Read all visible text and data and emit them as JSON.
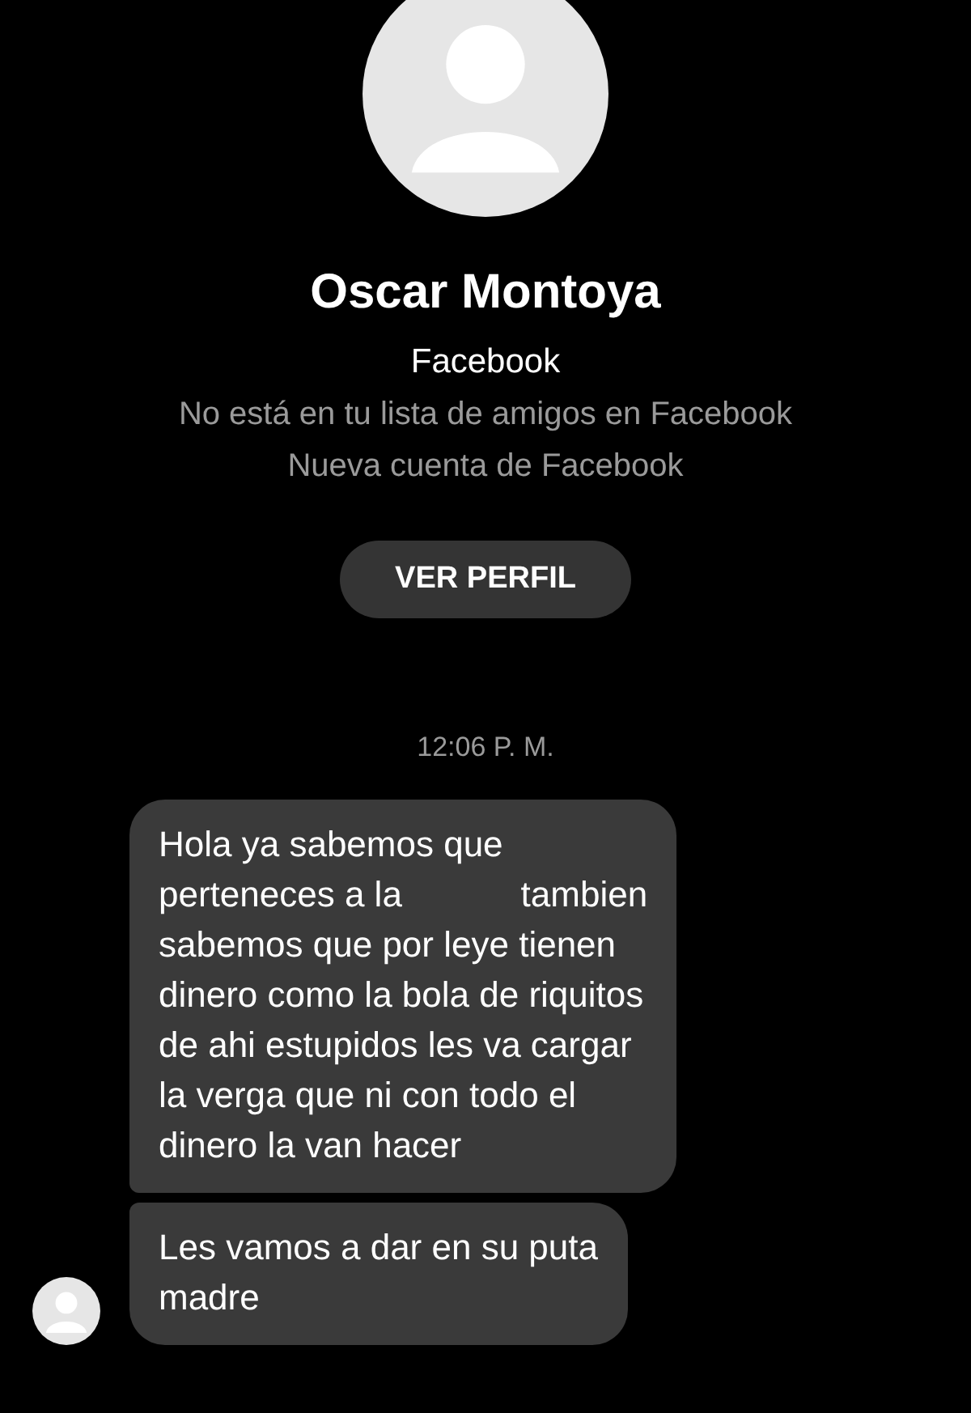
{
  "profile": {
    "name": "Oscar Montoya",
    "platform": "Facebook",
    "notes": [
      "No está en tu lista de amigos en Facebook",
      "Nueva cuenta de Facebook"
    ],
    "button": "VER PERFIL"
  },
  "timestamp": "12:06 P. M.",
  "messages": [
    {
      "text": "Hola ya sabemos que\nperteneces a la            tambien\nsabemos que por leye tienen\ndinero como la bola de riquitos\nde ahi estupidos les va cargar\nla verga que ni con todo el\ndinero la van hacer",
      "show_avatar": false
    },
    {
      "text": "Les vamos a dar en su puta\nmadre",
      "show_avatar": true
    }
  ]
}
